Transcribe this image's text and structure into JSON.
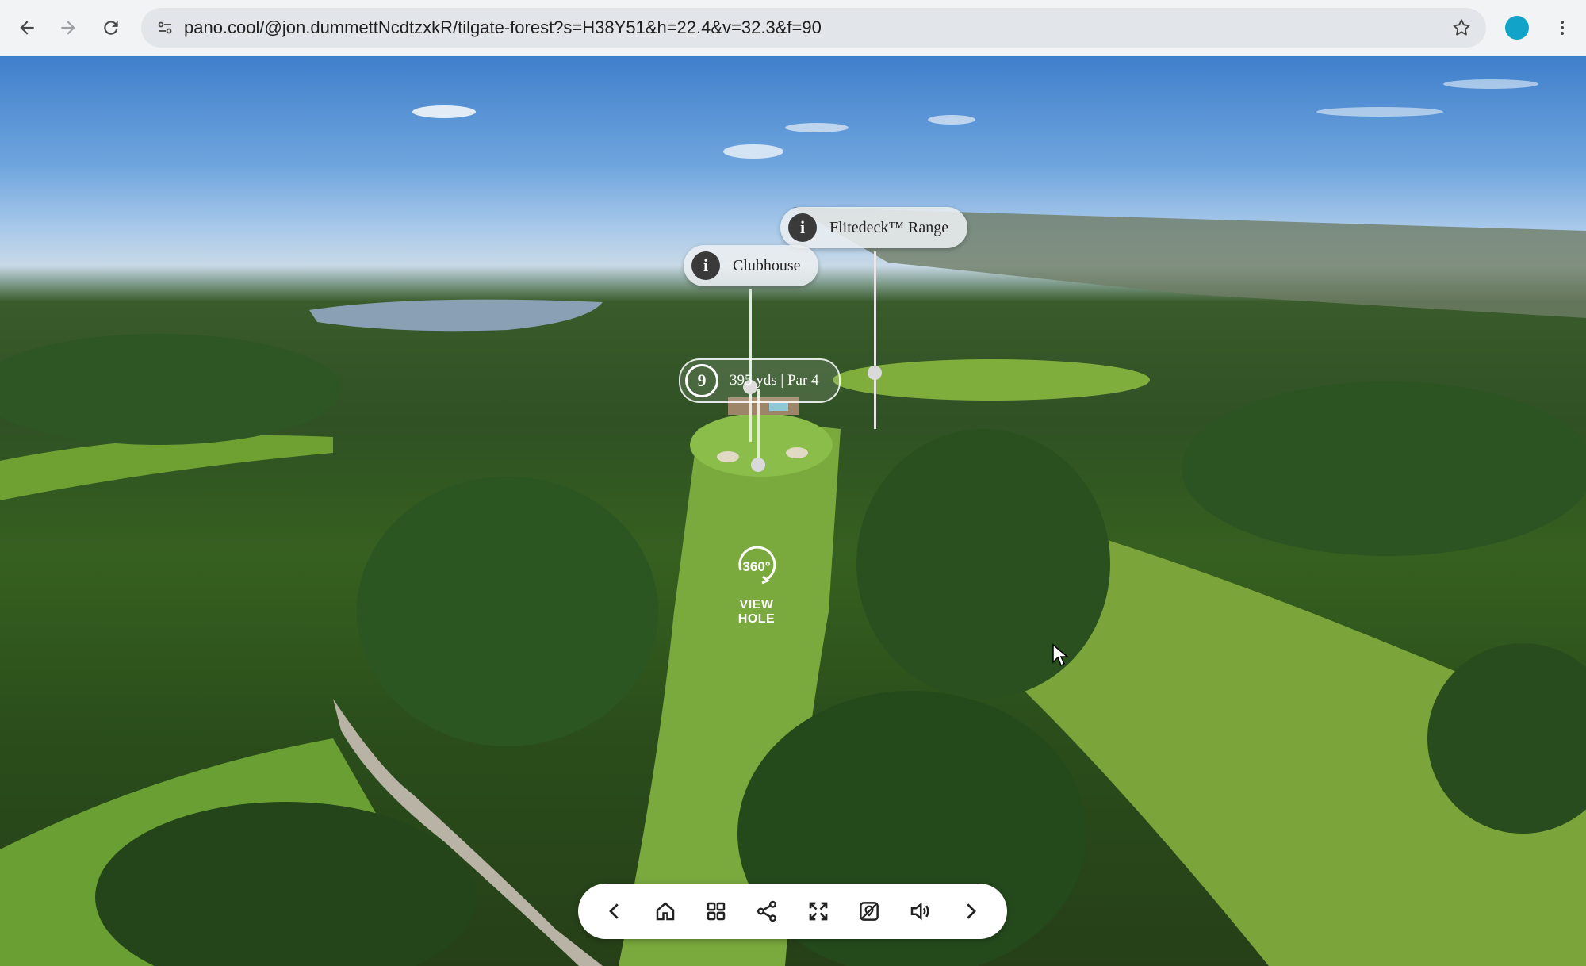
{
  "browser": {
    "url": "pano.cool/@jon.dummettNcdtzxkR/tilgate-forest?s=H38Y51&h=22.4&v=32.3&f=90",
    "icons": [
      "back-arrow-icon",
      "forward-arrow-icon",
      "reload-icon",
      "site-info-icon",
      "bookmark-star-icon",
      "profile-avatar",
      "more-vert-icon"
    ],
    "profile_color": "#12a4c8"
  },
  "hotspots": {
    "flitedeck": {
      "icon": "i",
      "label": "Flitedeck™ Range"
    },
    "clubhouse": {
      "icon": "i",
      "label": "Clubhouse"
    }
  },
  "hole_tag": {
    "number": "9",
    "text": "395 yds | Par 4"
  },
  "view_hole": {
    "badge": "360°",
    "label": "VIEW HOLE"
  },
  "toolbar": {
    "buttons": [
      "prev-icon",
      "home-icon",
      "grid-icon",
      "share-icon",
      "fullscreen-icon",
      "map-icon",
      "sound-icon",
      "next-icon"
    ]
  }
}
